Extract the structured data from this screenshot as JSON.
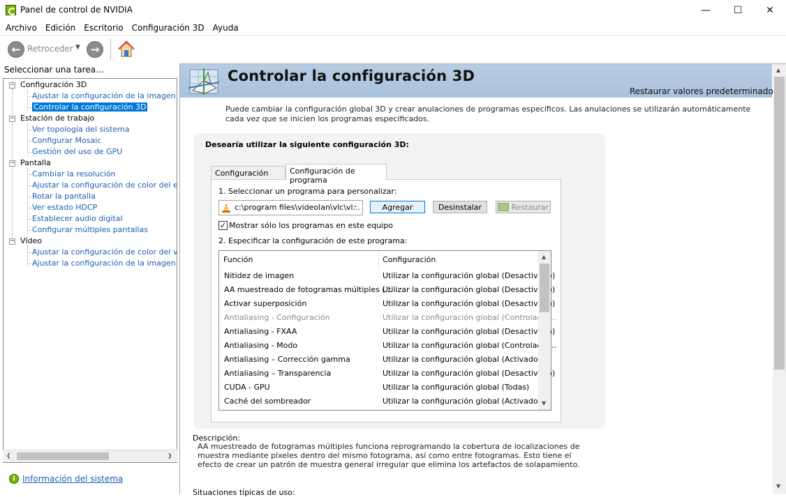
{
  "window": {
    "title": "Panel de control de NVIDIA",
    "minimize": "—",
    "maximize": "☐",
    "close": "✕"
  },
  "menu": [
    "Archivo",
    "Edición",
    "Escritorio",
    "Configuración 3D",
    "Ayuda"
  ],
  "toolbar": {
    "back_label": "Retroceder",
    "back_icon": "back-arrow-icon",
    "forward_icon": "forward-arrow-icon",
    "home_icon": "home-icon"
  },
  "sidebar": {
    "task_label": "Seleccionar una tarea...",
    "categories": [
      {
        "label": "Configuración 3D",
        "items": [
          "Ajustar la configuración de la imagen con v",
          "Controlar la configuración 3D"
        ]
      },
      {
        "label": "Estación de trabajo",
        "items": [
          "Ver topología del sistema",
          "Configurar Mosaic",
          "Gestión del uso de GPU"
        ]
      },
      {
        "label": "Pantalla",
        "items": [
          "Cambiar la resolución",
          "Ajustar la configuración de color del escrito",
          "Rotar la pantalla",
          "Ver estado HDCP",
          "Establecer audio digital",
          "Configurar múltiples pantallas"
        ]
      },
      {
        "label": "Vídeo",
        "items": [
          "Ajustar la configuración de color del vídeo",
          "Ajustar la configuración de la imagen de víc"
        ]
      }
    ],
    "selected_item": "Controlar la configuración 3D",
    "system_info_link": "Información del sistema"
  },
  "header": {
    "title": "Controlar la configuración 3D",
    "restore_defaults": "Restaurar valores predeterminados"
  },
  "intro": "Puede cambiar la configuración global 3D y crear anulaciones de programas específicos. Las anulaciones se utilizarán automáticamente cada vez que se inicien los programas especificados.",
  "settings": {
    "question": "Desearía utilizar la siguiente configuración 3D:",
    "tabs": [
      "Configuración global",
      "Configuración de programa"
    ],
    "active_tab": "Configuración de programa",
    "step1": "1. Seleccionar un programa para personalizar:",
    "program_value": "c:\\program files\\videolan\\vlc\\vl...",
    "add_button": "Agregar",
    "uninstall_button": "Desinstalar",
    "restore_button": "Restaurar",
    "show_only_checked": true,
    "checkmark": "✓",
    "show_only_label": "Mostrar sólo los programas en este equipo",
    "step2": "2. Especificar la configuración de este programa:",
    "table": {
      "headers": [
        "Función",
        "Configuración"
      ],
      "rows": [
        {
          "function": "Nitidez de imagen",
          "config": "Utilizar la configuración global (Desactivado)",
          "disabled": false
        },
        {
          "function": "AA muestreado de fotogramas múltiples (...",
          "config": "Utilizar la configuración global (Desactivado)",
          "disabled": false
        },
        {
          "function": "Activar superposición",
          "config": "Utilizar la configuración global (Desactivado)",
          "disabled": false
        },
        {
          "function": "Antialiasing - Configuración",
          "config": "Utilizar la configuración global (Controlado ...",
          "disabled": true
        },
        {
          "function": "Antialiasing - FXAA",
          "config": "Utilizar la configuración global (Desactivado)",
          "disabled": false
        },
        {
          "function": "Antialiasing - Modo",
          "config": "Utilizar la configuración global (Controlado ...",
          "disabled": false
        },
        {
          "function": "Antialiasing – Corrección gamma",
          "config": "Utilizar la configuración global (Activado)",
          "disabled": false
        },
        {
          "function": "Antialiasing – Transparencia",
          "config": "Utilizar la configuración global (Desactivado)",
          "disabled": false
        },
        {
          "function": "CUDA - GPU",
          "config": "Utilizar la configuración global (Todas)",
          "disabled": false
        },
        {
          "function": "Caché del sombreador",
          "config": "Utilizar la configuración global (Activado)",
          "disabled": false
        }
      ]
    }
  },
  "description": {
    "label": "Descripción:",
    "text": "AA muestreado de fotogramas múltiples funciona reprogramando la cobertura de localizaciones de muestra mediante píxeles dentro del mismo fotograma, así como entre fotogramas. Esto tiene el efecto de crear un patrón de muestra general irregular que elimina los artefactos de solapamiento."
  },
  "typical_label": "Situaciones típicas de uso:",
  "colors": {
    "header_band": "#b7cde3",
    "link": "#1a5fb4",
    "selection": "#0078d7",
    "nvidia_green": "#76b900"
  }
}
